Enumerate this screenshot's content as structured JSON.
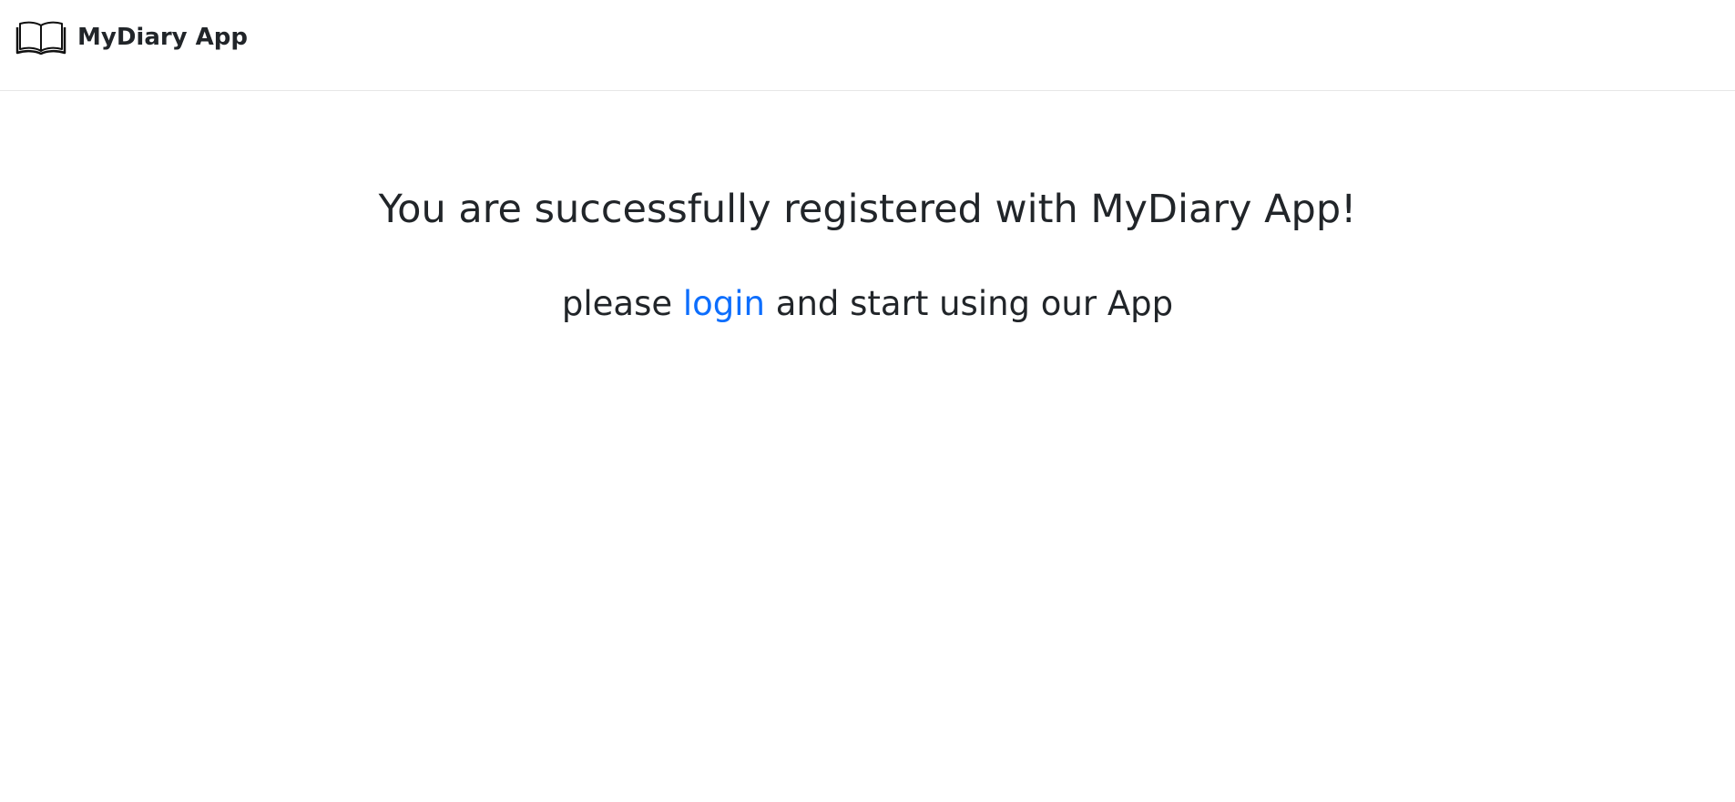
{
  "navbar": {
    "brand_label": "MyDiary App",
    "brand_icon": "open-book-icon"
  },
  "main": {
    "heading": "You are successfully registered with MyDiary App!",
    "message_before": "please ",
    "login_link": "login",
    "message_after": " and start using our App"
  },
  "colors": {
    "text": "#212529",
    "link": "#0d6efd",
    "divider": "#e6e6e6"
  }
}
